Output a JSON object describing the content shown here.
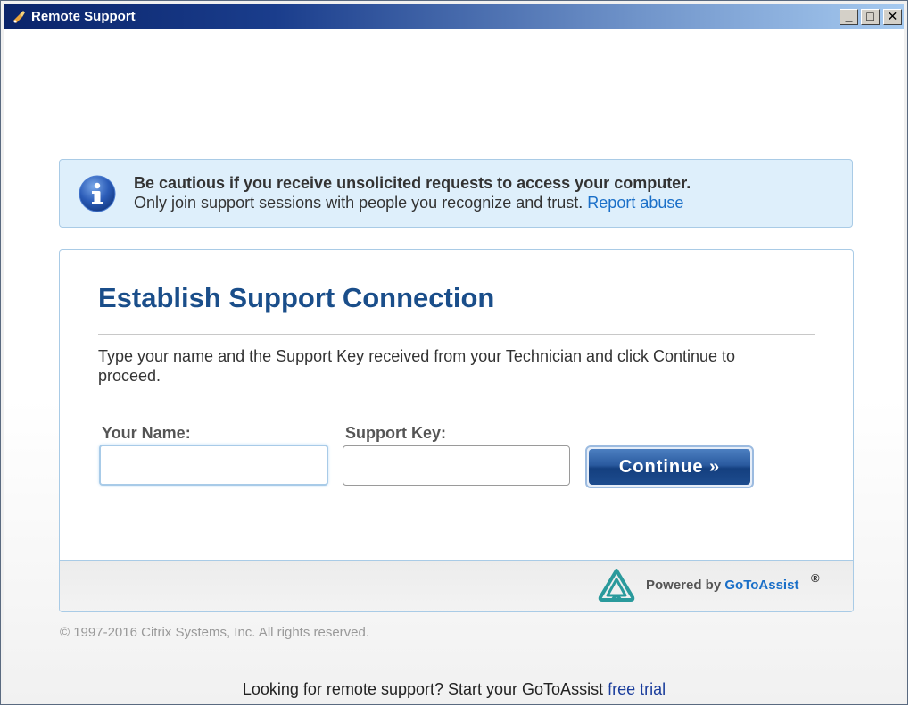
{
  "window": {
    "title": "Remote Support",
    "min_label": "_",
    "max_label": "□",
    "close_label": "✕"
  },
  "notice": {
    "title": "Be cautious if you receive unsolicited requests to access your computer.",
    "body": "Only join support sessions with people you recognize and trust.",
    "link": "Report abuse"
  },
  "panel": {
    "title": "Establish Support Connection",
    "instructions": "Type your name and the Support Key received from your Technician and click Continue to proceed.",
    "name_label": "Your Name:",
    "name_value": "",
    "key_label": "Support Key:",
    "key_value": "",
    "continue_label": "Continue »"
  },
  "footer": {
    "powered_by": "Powered by",
    "brand": "GoToAssist",
    "reg": "®"
  },
  "copyright": "© 1997-2016 Citrix Systems, Inc. All rights reserved.",
  "bottom": {
    "text": "Looking for remote support? Start your GoToAssist",
    "link": "free trial"
  },
  "colors": {
    "accent": "#1a4e8a",
    "link": "#1a6fc8",
    "notice_bg": "#deeffb"
  },
  "icons": {
    "app": "remote-support-app-icon",
    "info": "info-icon",
    "logo": "gotoassist-logo"
  }
}
